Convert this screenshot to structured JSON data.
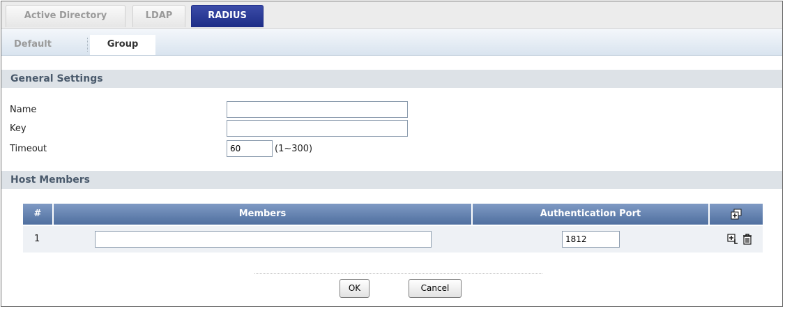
{
  "main_tabs": [
    {
      "label": "Active Directory",
      "active": false
    },
    {
      "label": "LDAP",
      "active": false
    },
    {
      "label": "RADIUS",
      "active": true
    }
  ],
  "sub_tabs": [
    {
      "label": "Default",
      "active": false
    },
    {
      "label": "Group",
      "active": true
    }
  ],
  "general": {
    "title": "General Settings",
    "name_label": "Name",
    "name_value": "",
    "key_label": "Key",
    "key_value": "",
    "timeout_label": "Timeout",
    "timeout_value": "60",
    "timeout_hint": "(1~300)"
  },
  "host_members": {
    "title": "Host Members",
    "columns": [
      "#",
      "Members",
      "Authentication Port"
    ],
    "header_icon": "add-row-icon",
    "rows": [
      {
        "index": "1",
        "member": "",
        "port": "1812",
        "icons": [
          "insert-icon",
          "delete-icon"
        ]
      }
    ]
  },
  "buttons": {
    "ok": "OK",
    "cancel": "Cancel"
  },
  "colors": {
    "active_tab": "#1d2c86",
    "table_header": "#5f7fb0",
    "section_bar": "#dde2e7"
  }
}
